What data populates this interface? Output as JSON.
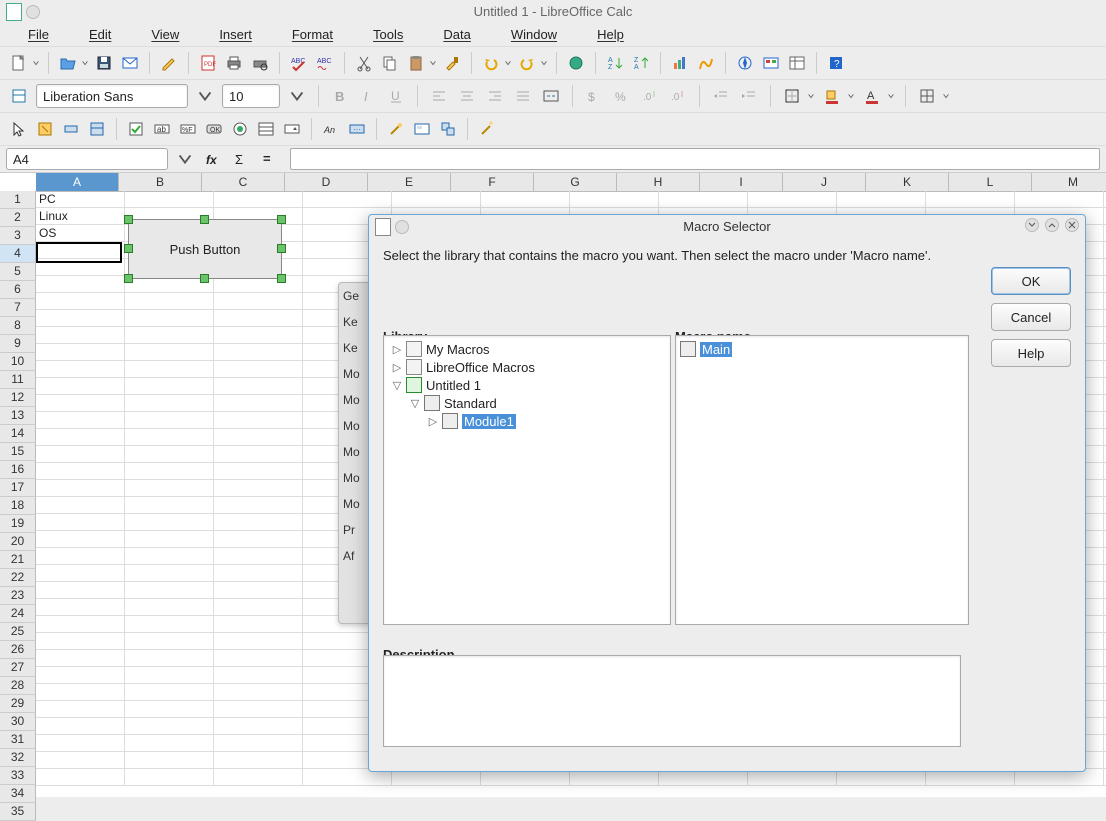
{
  "window": {
    "title": "Untitled 1 - LibreOffice Calc"
  },
  "menu": [
    "File",
    "Edit",
    "View",
    "Insert",
    "Format",
    "Tools",
    "Data",
    "Window",
    "Help"
  ],
  "font": {
    "name": "Liberation Sans",
    "size": "10"
  },
  "namebox": "A4",
  "cols": [
    "A",
    "B",
    "C",
    "D",
    "E",
    "F",
    "G",
    "H",
    "I",
    "J",
    "K",
    "L",
    "M"
  ],
  "rows_count": 35,
  "cells": {
    "A1": "PC",
    "A2": "Linux",
    "A3": "OS"
  },
  "columns_selected": "A",
  "active_row": 4,
  "pushbutton": {
    "label": "Push Button"
  },
  "bgpanel_items": [
    "Ge",
    "Ke",
    "Ke",
    "Mo",
    "Mo",
    "Mo",
    "Mo",
    "Mo",
    "Mo",
    "Pr",
    "Af"
  ],
  "dialog": {
    "title": "Macro Selector",
    "instruction": "Select the library that contains the macro you want. Then select the macro under 'Macro name'.",
    "library_label": "Library",
    "macroname_label": "Macro name",
    "description_label": "Description",
    "tree": {
      "my_macros": "My Macros",
      "lo_macros": "LibreOffice Macros",
      "doc": "Untitled 1",
      "standard": "Standard",
      "module": "Module1"
    },
    "macrolist": {
      "main": "Main"
    },
    "buttons": {
      "ok": "OK",
      "cancel": "Cancel",
      "help": "Help"
    }
  }
}
